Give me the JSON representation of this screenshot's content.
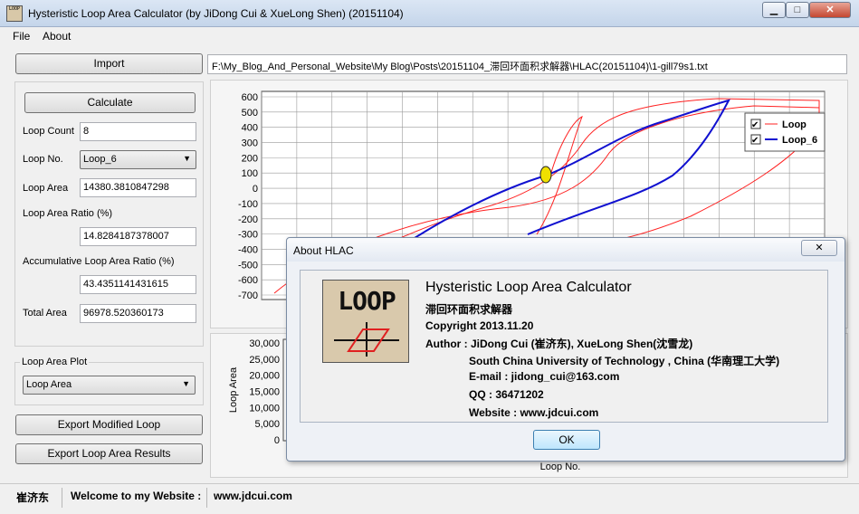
{
  "window": {
    "title": "Hysteristic Loop Area Calculator (by JiDong Cui & XueLong Shen) (20151104)",
    "icon_text": "LOOP"
  },
  "menu": {
    "file": "File",
    "about": "About"
  },
  "toolbar": {
    "import_label": "Import",
    "file_path": "F:\\My_Blog_And_Personal_Website\\My Blog\\Posts\\20151104_滞回环面积求解器\\HLAC(20151104)\\1-gill79s1.txt"
  },
  "left_panel": {
    "calculate_label": "Calculate",
    "loop_count_label": "Loop Count",
    "loop_count_value": "8",
    "loop_no_label": "Loop No.",
    "loop_no_value": "Loop_6",
    "loop_area_label": "Loop Area",
    "loop_area_value": "14380.3810847298",
    "loop_area_ratio_label": "Loop Area Ratio (%)",
    "loop_area_ratio_value": "14.8284187378007",
    "accum_ratio_label": "Accumulative Loop Area Ratio (%)",
    "accum_ratio_value": "43.4351141431615",
    "total_area_label": "Total Area",
    "total_area_value": "96978.520360173"
  },
  "plot_panel": {
    "group_label": "Loop Area Plot",
    "plot_type_value": "Loop Area",
    "export_loop_label": "Export Modified Loop",
    "export_results_label": "Export Loop Area Results"
  },
  "chart_data": [
    {
      "type": "line",
      "yticks": [
        "600",
        "500",
        "400",
        "300",
        "200",
        "100",
        "0",
        "-100",
        "-200",
        "-300",
        "-400",
        "-500",
        "-600",
        "-700"
      ],
      "ylim": [
        -700,
        600
      ],
      "grid": true,
      "legend_placement": "top-right",
      "series": [
        {
          "name": "Loop",
          "color": "#ff2020"
        },
        {
          "name": "Loop_6",
          "color": "#1010d0"
        }
      ]
    },
    {
      "type": "bar",
      "ylabel": "Loop Area",
      "xlabel": "Loop No.",
      "yticks": [
        "30,000",
        "25,000",
        "20,000",
        "15,000",
        "10,000",
        "5,000",
        "0"
      ],
      "ylim": [
        0,
        30000
      ]
    }
  ],
  "status": {
    "name": "崔济东",
    "welcome": "Welcome to my Website :",
    "website": "www.jdcui.com"
  },
  "about_dialog": {
    "title": "About HLAC",
    "close_label": "✕",
    "app_name": "Hysteristic Loop Area Calculator",
    "app_name_cn": "滞回环面积求解器",
    "copyright": "Copyright 2013.11.20",
    "author": "Author : JiDong Cui (崔济东), XueLong Shen(沈雪龙)",
    "university": "South China University of Technology , China (华南理工大学)",
    "email": "E-mail : jidong_cui@163.com",
    "qq": "QQ : 36471202",
    "website": "Website :  www.jdcui.com",
    "logo_text": "LOOP",
    "ok_label": "OK"
  }
}
